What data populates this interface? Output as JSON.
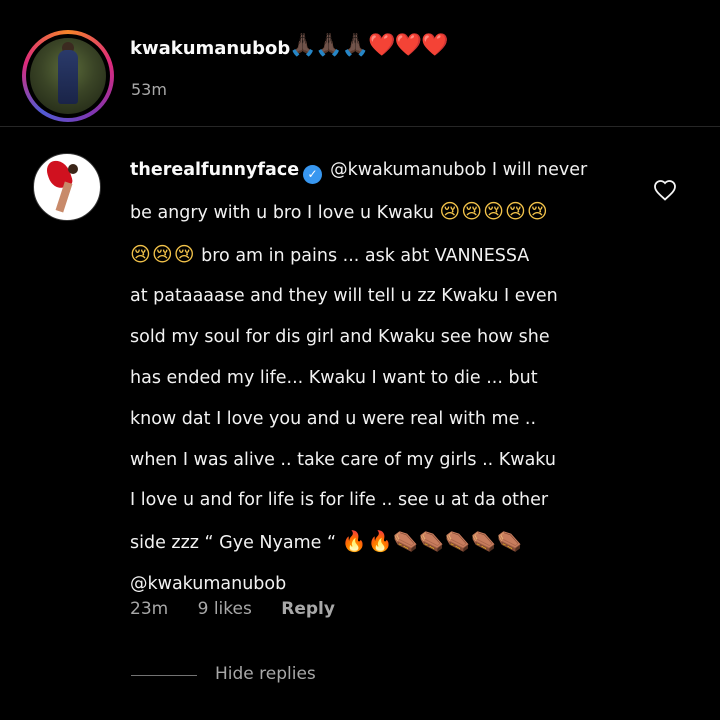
{
  "caption": {
    "username": "kwakumanubob",
    "emoji_text": "🙏🏿🙏🏿🙏🏿❤️❤️❤️",
    "time": "53m"
  },
  "comment": {
    "username": "therealfunnyface",
    "verified": true,
    "lines": [
      "@kwakumanubob I will never",
      "be angry with u bro I love u Kwaku",
      "bro am in pains ... ask abt VANNESSA",
      "at pataaaase and they will tell u zz Kwaku I even",
      "sold my soul for dis girl and Kwaku see how she",
      "has ended my life... Kwaku I want to die ... but",
      "know dat I love you and u were real with me ..",
      "when I was alive .. take care of my girls .. Kwaku",
      "I love u and for life is for life .. see u at da other",
      "side zzz “ Gye Nyame “",
      "@kwakumanubob"
    ],
    "emoji_after_line2": "😢😢😢😢😢",
    "emoji_before_line3": "😢😢😢",
    "emoji_after_line10_fire": "🔥🔥",
    "emoji_after_line10_coffin": "⚰️⚰️⚰️⚰️⚰️",
    "time": "23m",
    "likes": "9 likes",
    "reply_label": "Reply",
    "hide_replies_label": "Hide replies"
  },
  "colors": {
    "background": "#000000",
    "text": "#f5f5f5",
    "muted": "#a8a8a8",
    "verified_badge": "#3897f0",
    "heart": "#ed1c3b"
  },
  "icons": {
    "verified": "verified-badge-icon",
    "like": "heart-outline-icon"
  }
}
